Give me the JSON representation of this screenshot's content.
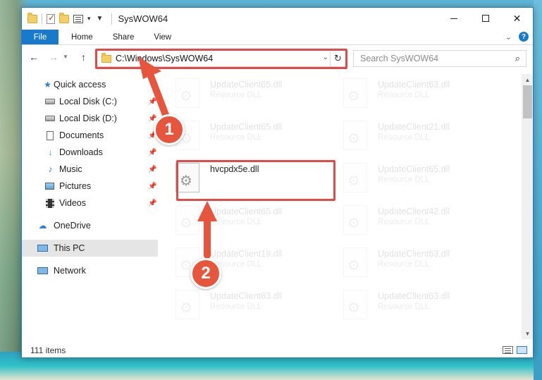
{
  "window": {
    "title": "SysWOW64"
  },
  "ribbon": {
    "tabs": [
      "File",
      "Home",
      "Share",
      "View"
    ]
  },
  "address": {
    "path": "C:\\Windows\\SysWOW64"
  },
  "search": {
    "placeholder": "Search SysWOW64"
  },
  "sidebar": {
    "items": [
      {
        "label": "Quick access",
        "icon": "star-icon"
      },
      {
        "label": "Local Disk (C:)",
        "icon": "drive-icon",
        "pinned": true
      },
      {
        "label": "Local Disk (D:)",
        "icon": "drive-icon",
        "pinned": true
      },
      {
        "label": "Documents",
        "icon": "documents-icon",
        "pinned": true
      },
      {
        "label": "Downloads",
        "icon": "downloads-icon",
        "pinned": true
      },
      {
        "label": "Music",
        "icon": "music-icon",
        "pinned": true
      },
      {
        "label": "Pictures",
        "icon": "pictures-icon",
        "pinned": true
      },
      {
        "label": "Videos",
        "icon": "videos-icon",
        "pinned": true
      },
      {
        "label": "OneDrive",
        "icon": "cloud-icon"
      },
      {
        "label": "This PC",
        "icon": "computer-icon",
        "selected": true
      },
      {
        "label": "Network",
        "icon": "network-icon"
      }
    ]
  },
  "files": [
    {
      "name": "UpdateClient65.dll",
      "type": "Resource DLL",
      "faded": true
    },
    {
      "name": "UpdateClient63.dll",
      "type": "Resource DLL",
      "faded": true
    },
    {
      "name": "UpdateClient65.dll",
      "type": "Resource DLL",
      "faded": true
    },
    {
      "name": "UpdateClient21.dll",
      "type": "Resource DLL",
      "faded": true
    },
    {
      "name": "hvcpdx5e.dll",
      "type": "",
      "faded": false
    },
    {
      "name": "UpdateClient65.dll",
      "type": "Resource DLL",
      "faded": true
    },
    {
      "name": "UpdateClient65.dll",
      "type": "Resource DLL",
      "faded": true
    },
    {
      "name": "UpdateClient42.dll",
      "type": "Resource DLL",
      "faded": true
    },
    {
      "name": "UpdateClient19.dll",
      "type": "Resource DLL",
      "faded": true
    },
    {
      "name": "UpdateClient63.dll",
      "type": "Resource DLL",
      "faded": true
    },
    {
      "name": "UpdateClient63.dll",
      "type": "Resource DLL",
      "faded": true
    },
    {
      "name": "UpdateClient63.dll",
      "type": "Resource DLL",
      "faded": true
    }
  ],
  "status": {
    "item_count": "111 items"
  },
  "annotations": {
    "step1": "1",
    "step2": "2",
    "color": "#e8553d"
  }
}
